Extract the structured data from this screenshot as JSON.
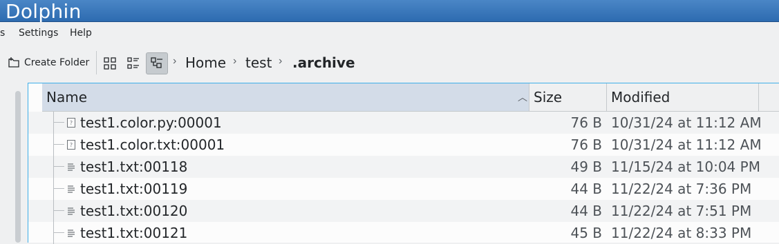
{
  "window": {
    "title": "Dolphin"
  },
  "menubar": {
    "items": [
      "s",
      "Settings",
      "Help"
    ]
  },
  "toolbar": {
    "create_folder_label": "Create Folder",
    "view_modes": [
      {
        "icon": "icons-view-icon",
        "active": false
      },
      {
        "icon": "compact-view-icon",
        "active": false
      },
      {
        "icon": "details-view-icon",
        "active": true
      }
    ],
    "breadcrumb": [
      "Home",
      "test",
      ".archive"
    ]
  },
  "columns": {
    "name": "Name",
    "size": "Size",
    "modified": "Modified"
  },
  "files": [
    {
      "name": "test1.color.py:00001",
      "size": "76 B",
      "modified": "10/31/24 at 11:12 AM",
      "icon": "unknown-file-icon"
    },
    {
      "name": "test1.color.txt:00001",
      "size": "76 B",
      "modified": "10/31/24 at 11:12 AM",
      "icon": "unknown-file-icon"
    },
    {
      "name": "test1.txt:00118",
      "size": "49 B",
      "modified": "11/15/24 at 10:04 PM",
      "icon": "text-file-icon"
    },
    {
      "name": "test1.txt:00119",
      "size": "44 B",
      "modified": "11/22/24 at 7:36 PM",
      "icon": "text-file-icon"
    },
    {
      "name": "test1.txt:00120",
      "size": "44 B",
      "modified": "11/22/24 at 7:51 PM",
      "icon": "text-file-icon"
    },
    {
      "name": "test1.txt:00121",
      "size": "45 B",
      "modified": "11/22/24 at 8:33 PM",
      "icon": "text-file-icon"
    }
  ],
  "colors": {
    "accent": "#3daee9",
    "titlebar": "#2d6bb0",
    "sorted_header": "#d3dce8"
  }
}
